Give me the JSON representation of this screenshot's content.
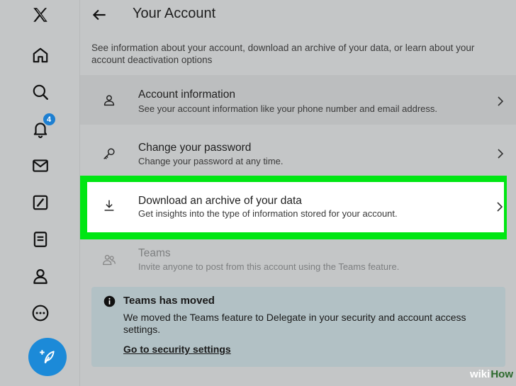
{
  "sidebar": {
    "items": [
      {
        "name": "x-logo-icon"
      },
      {
        "name": "home-icon"
      },
      {
        "name": "search-icon"
      },
      {
        "name": "notifications-bell-icon",
        "badge": "4"
      },
      {
        "name": "messages-mail-icon"
      },
      {
        "name": "grok-slash-icon"
      },
      {
        "name": "lists-icon"
      },
      {
        "name": "profile-person-icon"
      },
      {
        "name": "more-circle-icon"
      }
    ],
    "post_button_icon": "feather-plus-icon"
  },
  "header": {
    "back_icon": "arrow-left-icon",
    "title": "Your Account"
  },
  "description": "See information about your account, download an archive of your data, or learn about your account deactivation options",
  "settings": [
    {
      "icon": "person-icon",
      "title": "Account information",
      "subtitle": "See your account information like your phone number and email address."
    },
    {
      "icon": "key-icon",
      "title": "Change your password",
      "subtitle": "Change your password at any time."
    },
    {
      "icon": "download-icon",
      "title": "Download an archive of your data",
      "subtitle": "Get insights into the type of information stored for your account."
    },
    {
      "icon": "people-icon",
      "title": "Teams",
      "subtitle": "Invite anyone to post from this account using the Teams feature."
    }
  ],
  "notice": {
    "icon": "info-icon",
    "title": "Teams has moved",
    "text": "We moved the Teams feature to Delegate in your security and account access settings.",
    "link": "Go to security settings"
  },
  "watermark": {
    "prefix": "wiki",
    "suffix": "How"
  },
  "colors": {
    "highlight": "#00e613",
    "accent": "#1c8ad8",
    "badge": "#1d7fd1",
    "notice_bg": "#b2c1c5"
  }
}
